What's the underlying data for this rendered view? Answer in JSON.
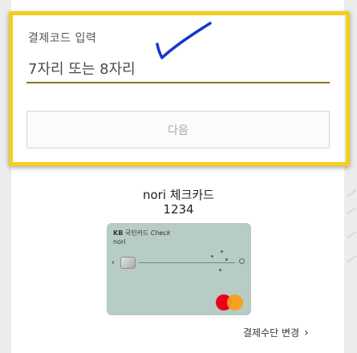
{
  "payment_code": {
    "label": "결제코드 입력",
    "placeholder": "7자리 또는 8자리",
    "value": ""
  },
  "next_button": {
    "label": "다음"
  },
  "card": {
    "name": "nori 체크카드",
    "number": "1234",
    "brand_issuer": "KB",
    "brand_name": "국민카드",
    "brand_type": "Check",
    "product": "nori",
    "color": "#b6ccc5",
    "network_icon": "mastercard-logo"
  },
  "change_payment": {
    "label": "결제수단 변경",
    "icon": "chevron-right-icon"
  },
  "colors": {
    "highlight_border": "#f3cf1d",
    "checkmark": "#1a35c8",
    "input_underline": "#8a7420"
  }
}
